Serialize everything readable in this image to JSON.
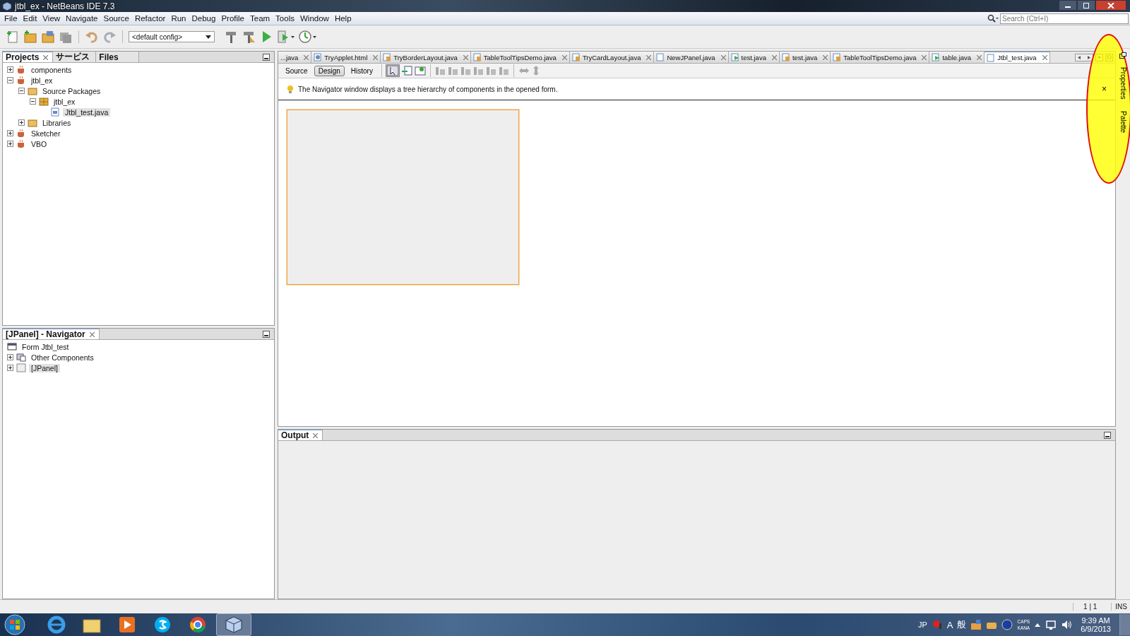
{
  "window": {
    "title": "jtbl_ex - NetBeans IDE 7.3"
  },
  "menu": [
    "File",
    "Edit",
    "View",
    "Navigate",
    "Source",
    "Refactor",
    "Run",
    "Debug",
    "Profile",
    "Team",
    "Tools",
    "Window",
    "Help"
  ],
  "search": {
    "placeholder": "Search (Ctrl+I)"
  },
  "toolbar": {
    "config": "<default config>"
  },
  "projects_panel": {
    "tabs": [
      {
        "label": "Projects",
        "selected": true,
        "closable": true
      },
      {
        "label": "サービス",
        "selected": false,
        "closable": false
      },
      {
        "label": "Files",
        "selected": false,
        "closable": false
      }
    ],
    "tree": [
      {
        "label": "components",
        "kind": "project",
        "expanded": false,
        "selected": false
      },
      {
        "label": "jtbl_ex",
        "kind": "project",
        "expanded": true,
        "selected": false,
        "children": [
          {
            "label": "Source Packages",
            "kind": "folder",
            "expanded": true,
            "selected": false,
            "children": [
              {
                "label": "jtbl_ex",
                "kind": "package",
                "expanded": true,
                "selected": false,
                "children": [
                  {
                    "label": "Jtbl_test.java",
                    "kind": "form",
                    "selected": true
                  }
                ]
              }
            ]
          },
          {
            "label": "Libraries",
            "kind": "folder",
            "expanded": false,
            "selected": false
          }
        ]
      },
      {
        "label": "Sketcher",
        "kind": "project",
        "expanded": false,
        "selected": false
      },
      {
        "label": "VBO",
        "kind": "project",
        "expanded": false,
        "selected": false
      }
    ]
  },
  "navigator_panel": {
    "title": "[JPanel] - Navigator",
    "tree": [
      {
        "label": "Form Jtbl_test",
        "kind": "form-root",
        "selected": false
      },
      {
        "label": "Other Components",
        "kind": "components",
        "expanded": false,
        "selected": false
      },
      {
        "label": "[JPanel]",
        "kind": "panel",
        "expanded": false,
        "selected": true
      }
    ]
  },
  "editor_tabs": [
    {
      "label": "...java",
      "kind": "cut",
      "selected": false
    },
    {
      "label": "TryApplet.html",
      "kind": "html",
      "selected": false
    },
    {
      "label": "TryBorderLayout.java",
      "kind": "form",
      "selected": false
    },
    {
      "label": "TableToolTipsDemo.java",
      "kind": "form",
      "selected": false
    },
    {
      "label": "TryCardLayout.java",
      "kind": "form",
      "selected": false
    },
    {
      "label": "NewJPanel.java",
      "kind": "file",
      "selected": false
    },
    {
      "label": "test.java",
      "kind": "run",
      "selected": false
    },
    {
      "label": "test.java",
      "kind": "form",
      "selected": false
    },
    {
      "label": "TableToolTipsDemo.java",
      "kind": "form",
      "selected": false
    },
    {
      "label": "table.java",
      "kind": "run",
      "selected": false
    },
    {
      "label": "Jtbl_test.java",
      "kind": "file",
      "selected": true
    }
  ],
  "editor_views": [
    {
      "label": "Source",
      "selected": false
    },
    {
      "label": "Design",
      "selected": true
    },
    {
      "label": "History",
      "selected": false
    }
  ],
  "hint": {
    "text": "The Navigator window displays a tree hierarchy of components in the opened form.",
    "close": "×"
  },
  "output_panel": {
    "title": "Output"
  },
  "side_tabs": [
    "Properties",
    "Palette"
  ],
  "status_bar": {
    "position": "1 | 1",
    "mode": "INS"
  },
  "tray": {
    "language": "JP",
    "ime_mode": "A",
    "ime_kanji": "般",
    "caps": "CAPS",
    "kana": "KANA",
    "time": "9:39 AM",
    "date": "6/9/2013"
  },
  "annotation": {
    "kind": "ellipse"
  }
}
